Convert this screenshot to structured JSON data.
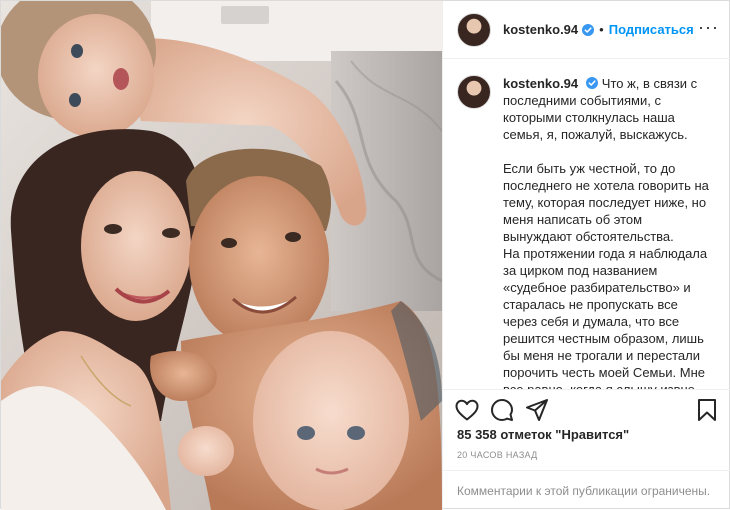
{
  "account": {
    "username": "kostenko.94",
    "follow_label": "Подписаться",
    "separator": "•",
    "more_label": "···"
  },
  "caption": {
    "username": "kostenko.94",
    "paragraphs": [
      "Что ж, в связи с последними событиями, с которыми столкнулась наша семья, я, пожалуй, выскажусь.",
      "Если быть уж честной, то до последнего не хотела говорить на тему, которая последует ниже, но меня написать об этом вынуждают обстоятельства.",
      "На протяжении года я наблюдала за цирком под названием «судебное разбирательство» и",
      "старалась не пропускать все через себя и думала, что все решится честным образом, лишь бы меня не трогали и перестали порочить честь моей Семьи. Мне все равно, когда я слышу извне какие-то небылицы насчёт себя, но я никогда не буду"
    ]
  },
  "stats": {
    "likes": "85 358 отметок \"Нравится\"",
    "time": "20 часов назад"
  },
  "comments_notice": "Комментарии к этой публикации ограничены.",
  "colors": {
    "accent": "#0095f6",
    "verified": "#3897f0",
    "text": "#262626",
    "muted": "#8e8e8e",
    "border": "#efefef"
  },
  "icons": {
    "like": "heart-icon",
    "comment": "comment-icon",
    "share": "paper-plane-icon",
    "save": "bookmark-icon",
    "verified": "verified-badge-icon"
  }
}
